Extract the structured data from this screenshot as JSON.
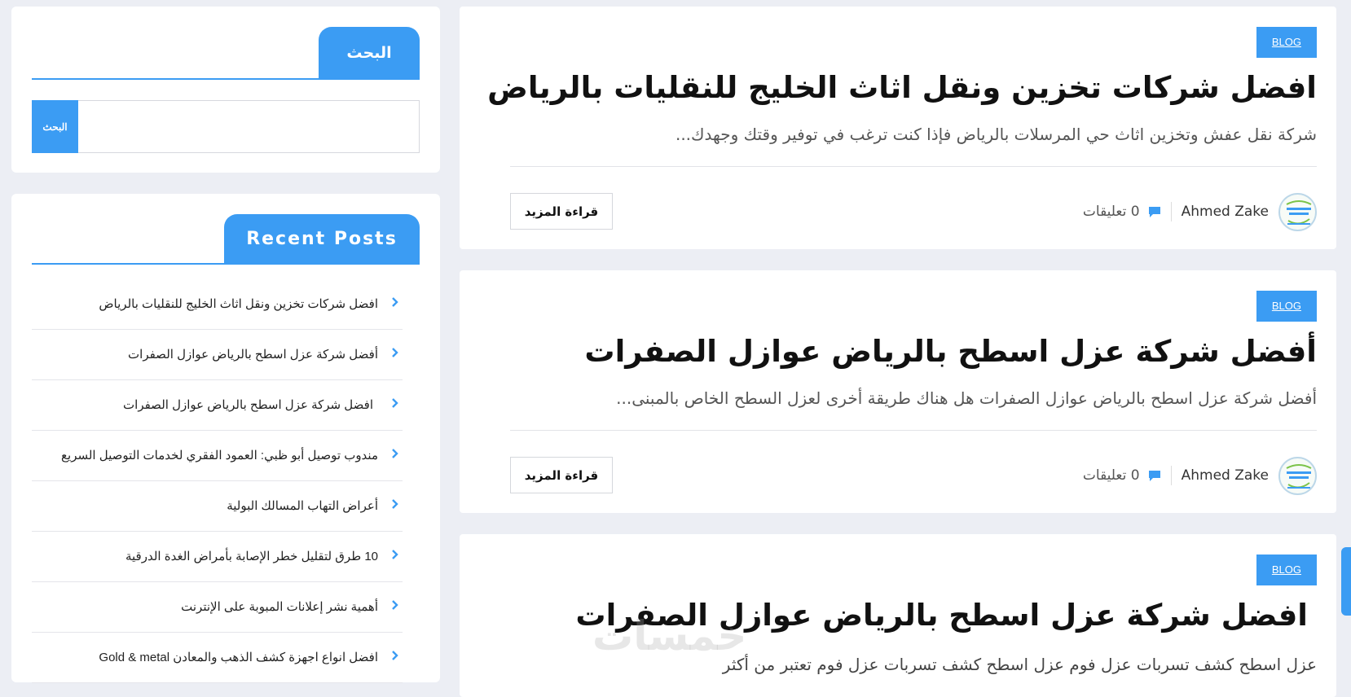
{
  "search_widget": {
    "title": "البحث",
    "placeholder": "",
    "button_label": "البحث"
  },
  "recent_widget": {
    "title": "Recent Posts",
    "items": [
      {
        "label": "افضل شركات تخزين ونقل اثاث الخليج للنقليات بالرياض"
      },
      {
        "label": "أفضل شركة عزل اسطح بالرياض عوازل الصفرات"
      },
      {
        "label": "افضل شركة عزل اسطح بالرياض عوازل الصفرات"
      },
      {
        "label": "مندوب توصيل أبو ظبي: العمود الفقري لخدمات التوصيل السريع"
      },
      {
        "label": "أعراض التهاب المسالك البولية"
      },
      {
        "label": "10 طرق لتقليل خطر الإصابة بأمراض الغدة الدرقية"
      },
      {
        "label": "أهمية نشر إعلانات المبوبة على الإنترنت"
      },
      {
        "label": "افضل انواع اجهزة كشف الذهب والمعادن Gold & metal"
      }
    ]
  },
  "posts": [
    {
      "category": "BLOG",
      "title": "افضل شركات تخزين ونقل اثاث الخليج للنقليات بالرياض",
      "excerpt": "شركة نقل عفش وتخزين اثاث حي المرسلات بالرياض فإذا كنت ترغب في توفير وقتك وجهدك...",
      "author": "Ahmed Zake",
      "comments": "0 تعليقات",
      "read_more": "قراءة المزيد"
    },
    {
      "category": "BLOG",
      "title": "أفضل شركة عزل اسطح بالرياض عوازل الصفرات",
      "excerpt": "أفضل شركة عزل اسطح بالرياض عوازل الصفرات  هل هناك طريقة أخرى لعزل السطح الخاص بالمبنى...",
      "author": "Ahmed Zake",
      "comments": "0 تعليقات",
      "read_more": "قراءة المزيد"
    },
    {
      "category": "BLOG",
      "title": "افضل شركة عزل اسطح بالرياض عوازل الصفرات",
      "excerpt": "عزل اسطح كشف تسربات عزل فوم عزل اسطح كشف تسربات عزل فوم تعتبر من أكثر"
    }
  ],
  "watermark": "خمسات",
  "colors": {
    "accent": "#3b9cf3",
    "page_bg": "#eceef4"
  },
  "icons": {
    "list_bullet": "chevron-right-icon",
    "comments": "comment-icon"
  }
}
